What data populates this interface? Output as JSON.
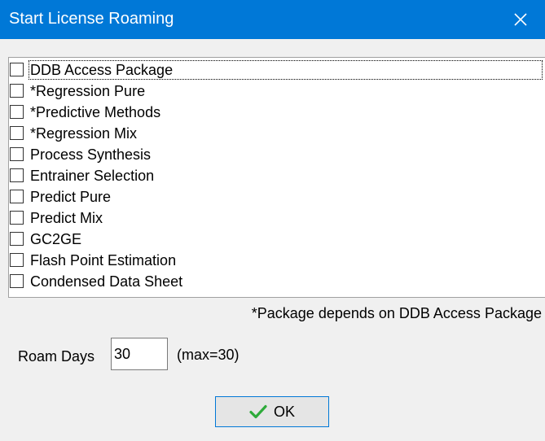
{
  "window": {
    "title": "Start License Roaming",
    "close_icon": "close-icon",
    "accent_color": "#0078d7"
  },
  "packages": [
    {
      "label": "DDB Access Package",
      "checked": false,
      "focused": true
    },
    {
      "label": "*Regression Pure",
      "checked": false
    },
    {
      "label": "*Predictive Methods",
      "checked": false
    },
    {
      "label": "*Regression Mix",
      "checked": false
    },
    {
      "label": "Process Synthesis",
      "checked": false
    },
    {
      "label": "Entrainer Selection",
      "checked": false
    },
    {
      "label": "Predict Pure",
      "checked": false
    },
    {
      "label": "Predict Mix",
      "checked": false
    },
    {
      "label": "GC2GE",
      "checked": false
    },
    {
      "label": "Flash Point Estimation",
      "checked": false
    },
    {
      "label": "Condensed Data Sheet",
      "checked": false
    }
  ],
  "note": "*Package depends on DDB Access Package",
  "roam": {
    "label": "Roam Days",
    "value": "30",
    "max_text": "(max=30)"
  },
  "ok_button": {
    "label": "OK",
    "icon": "checkmark-icon",
    "icon_color": "#2eab3a"
  }
}
